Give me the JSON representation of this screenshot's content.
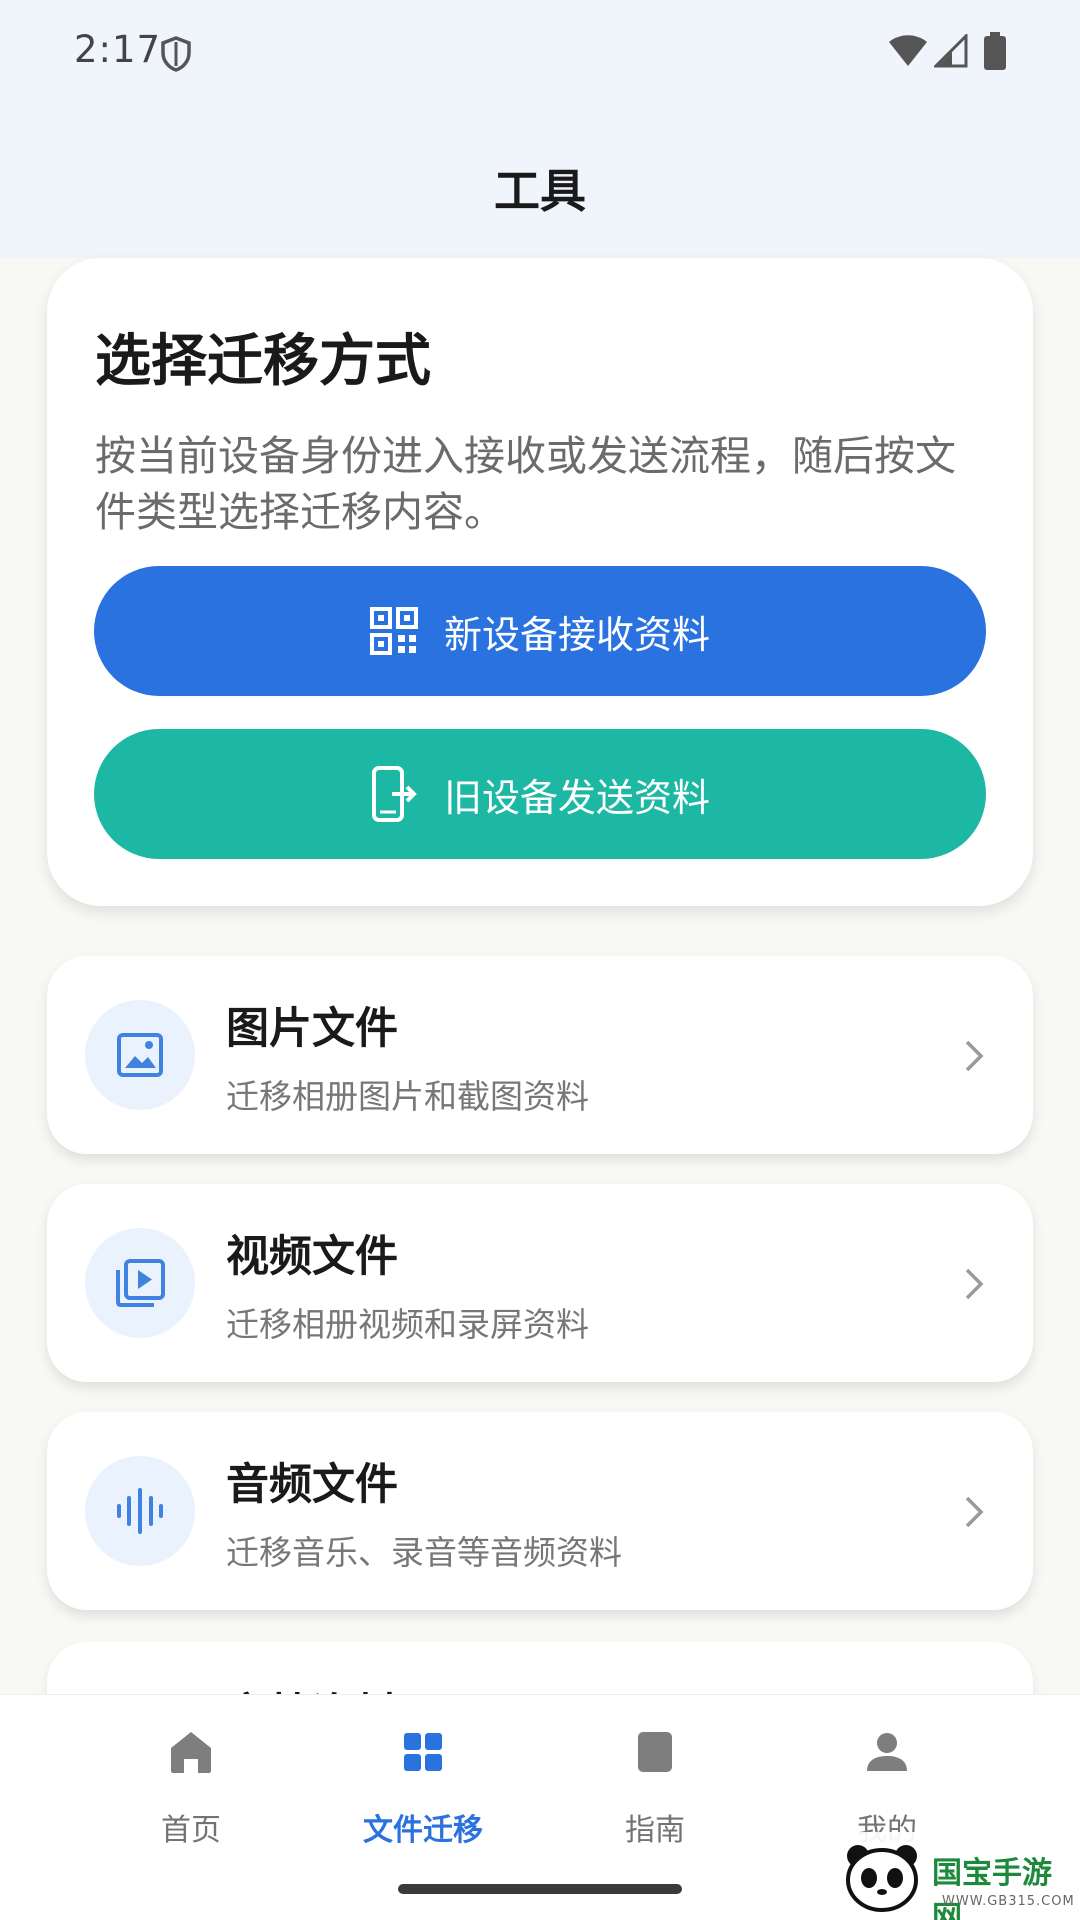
{
  "status": {
    "time": "2:17"
  },
  "header": {
    "title": "工具"
  },
  "migrate": {
    "title": "选择迁移方式",
    "desc": "按当前设备身份进入接收或发送流程，随后按文件类型选择迁移内容。",
    "receive_label": "新设备接收资料",
    "send_label": "旧设备发送资料"
  },
  "files": [
    {
      "title": "图片文件",
      "sub": "迁移相册图片和截图资料",
      "icon": "image-icon"
    },
    {
      "title": "视频文件",
      "sub": "迁移相册视频和录屏资料",
      "icon": "video-icon"
    },
    {
      "title": "音频文件",
      "sub": "迁移音乐、录音等音频资料",
      "icon": "audio-icon"
    },
    {
      "title": "文档资料"
    }
  ],
  "nav": {
    "items": [
      {
        "label": "首页",
        "icon": "home-icon"
      },
      {
        "label": "文件迁移",
        "icon": "grid-icon",
        "active": true
      },
      {
        "label": "指南",
        "icon": "book-icon"
      },
      {
        "label": "我的",
        "icon": "person-icon"
      }
    ]
  },
  "watermark": {
    "brand": "国宝手游网",
    "url": "WWW.GB315.COM"
  },
  "colors": {
    "primary": "#2a72e0",
    "teal": "#1cb8a3",
    "background": "#f0f4fb"
  }
}
